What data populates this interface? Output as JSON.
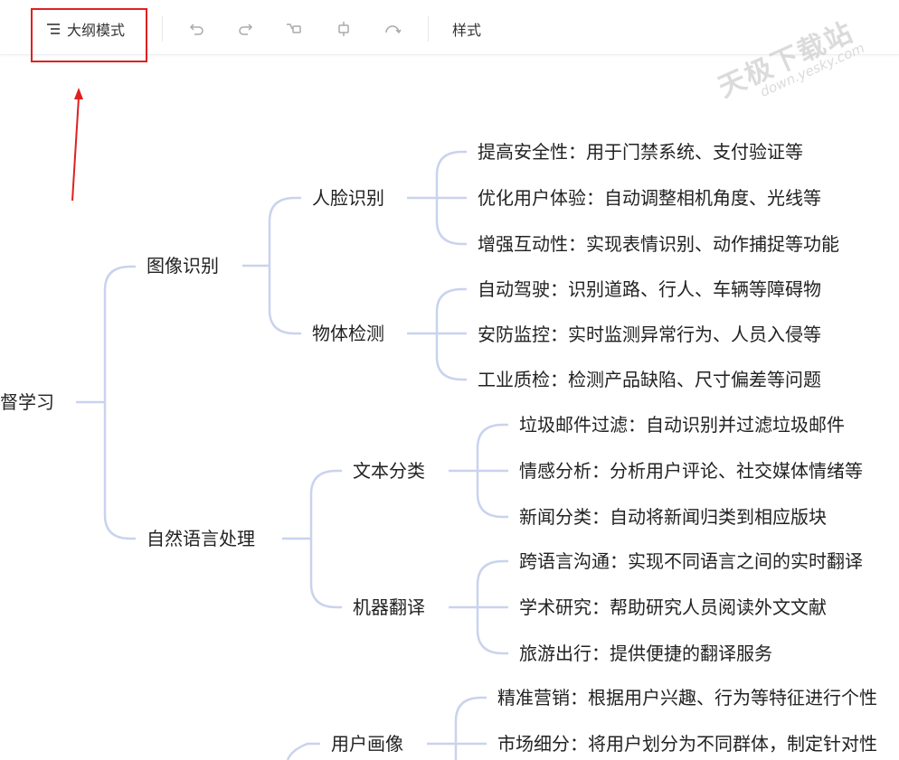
{
  "toolbar": {
    "outline_label": "大纲模式",
    "style_label": "样式",
    "icons": [
      "outline-list-icon",
      "undo-icon",
      "redo-icon",
      "add-child-icon",
      "add-sibling-icon",
      "relation-icon"
    ]
  },
  "watermark": {
    "main": "天极下载站",
    "sub": "down.yesky.com"
  },
  "colors": {
    "highlight": "#e02020",
    "connector": "#c9d3ee",
    "text": "#222222"
  },
  "mindmap": {
    "root": "督学习",
    "image_recognition": "图像识别",
    "face_recognition": "人脸识别",
    "face_items": [
      "提高安全性：用于门禁系统、支付验证等",
      "优化用户体验：自动调整相机角度、光线等",
      "增强互动性：实现表情识别、动作捕捉等功能"
    ],
    "object_detection": "物体检测",
    "object_items": [
      "自动驾驶：识别道路、行人、车辆等障碍物",
      "安防监控：实时监测异常行为、人员入侵等",
      "工业质检：检测产品缺陷、尺寸偏差等问题"
    ],
    "nlp": "自然语言处理",
    "text_classification": "文本分类",
    "text_items": [
      "垃圾邮件过滤：自动识别并过滤垃圾邮件",
      "情感分析：分析用户评论、社交媒体情绪等",
      "新闻分类：自动将新闻归类到相应版块"
    ],
    "machine_translation": "机器翻译",
    "translation_items": [
      "跨语言沟通：实现不同语言之间的实时翻译",
      "学术研究：帮助研究人员阅读外文文献",
      "旅游出行：提供便捷的翻译服务"
    ],
    "user_profile": "用户画像",
    "profile_items": [
      "精准营销：根据用户兴趣、行为等特征进行个性",
      "市场细分：将用户划分为不同群体，制定针对性"
    ]
  }
}
